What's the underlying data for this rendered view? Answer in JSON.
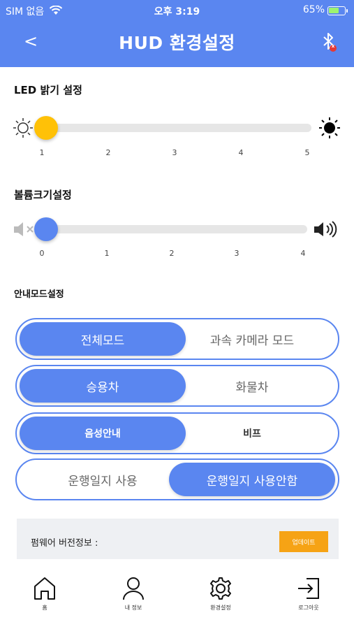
{
  "status": {
    "carrier": "SIM 없음",
    "time": "오후 3:19",
    "battery": "65%",
    "battery_level": 0.65
  },
  "header": {
    "back_label": "<",
    "title": "HUD 환경설정",
    "bluetooth_badge": "x"
  },
  "led": {
    "title": "LED 밝기 설정",
    "ticks": [
      "1",
      "2",
      "3",
      "4",
      "5"
    ],
    "value": 1,
    "knob_color": "#ffc107"
  },
  "volume": {
    "title": "볼륨크기설정",
    "ticks": [
      "0",
      "1",
      "2",
      "3",
      "4"
    ],
    "value": 0,
    "knob_color": "#5a86f0"
  },
  "guide": {
    "title": "안내모드설정",
    "mode": {
      "left": "전체모드",
      "right": "과속 카메라 모드",
      "selected": "left"
    },
    "vehicle": {
      "left": "승용차",
      "right": "화물차",
      "selected": "left"
    },
    "sound": {
      "left": "음성안내",
      "right": "비프",
      "selected": "left"
    },
    "log": {
      "left": "운행일지 사용",
      "right": "운행일지 사용안함",
      "selected": "right"
    }
  },
  "firmware": {
    "label": "펌웨어 버전정보 :",
    "update_button": "업데이트"
  },
  "tabs": [
    {
      "label": "홈",
      "icon": "home-icon"
    },
    {
      "label": "내 정보",
      "icon": "user-icon"
    },
    {
      "label": "환경설정",
      "icon": "gear-icon"
    },
    {
      "label": "로그아웃",
      "icon": "logout-icon"
    }
  ],
  "colors": {
    "primary": "#5a86f0",
    "accent": "#f6a315",
    "led_knob": "#ffc107"
  }
}
